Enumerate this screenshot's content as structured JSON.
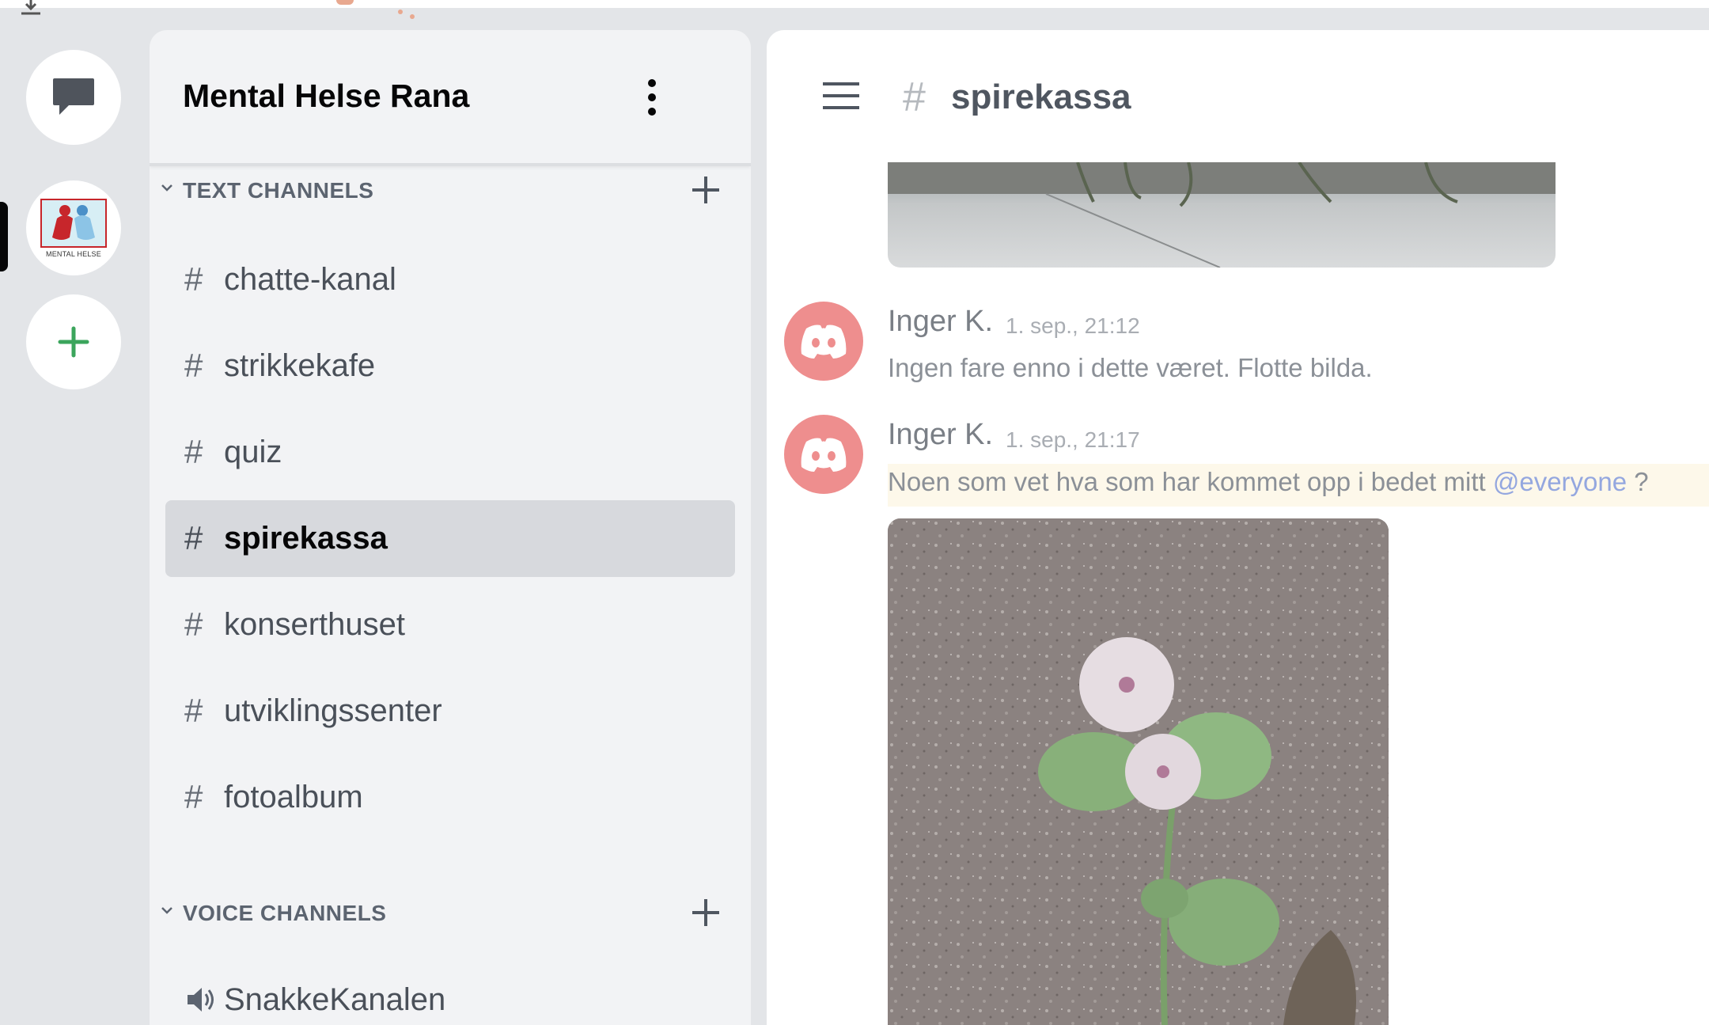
{
  "colors": {
    "accent_green": "#3ba55c",
    "mention": "#94a7df",
    "avatar": "#ee8e8e",
    "active_channel": "#d7d9dd"
  },
  "rail": {
    "dm_icon": "chat-bubble-icon",
    "server_logo_text": "MENTAL HELSE",
    "add_icon": "plus-icon"
  },
  "guild": {
    "name": "Mental Helse Rana",
    "menu_icon": "kebab-icon"
  },
  "text_category": {
    "label": "TEXT CHANNELS"
  },
  "text_channels": [
    {
      "hash": "#",
      "name": "chatte-kanal"
    },
    {
      "hash": "#",
      "name": "strikkekafe"
    },
    {
      "hash": "#",
      "name": "quiz"
    },
    {
      "hash": "#",
      "name": "spirekassa",
      "active": true
    },
    {
      "hash": "#",
      "name": "konserthuset"
    },
    {
      "hash": "#",
      "name": "utviklingssenter"
    },
    {
      "hash": "#",
      "name": "fotoalbum"
    }
  ],
  "voice_category": {
    "label": "VOICE CHANNELS"
  },
  "voice_channels": [
    {
      "name": "SnakkeKanalen",
      "icon": "speaker-icon"
    }
  ],
  "chat": {
    "hash": "#",
    "channel": "spirekassa",
    "messages": [
      {
        "author": "Inger K.",
        "time": "1. sep., 21:12",
        "text": "Ingen fare enno i dette været.   Flotte bilda."
      },
      {
        "author": "Inger K.",
        "time": "1. sep., 21:17",
        "text_before": "Noen som vet hva som har kommet opp i bedet mitt ",
        "mention": "@everyone",
        "text_after": " ?"
      }
    ]
  }
}
